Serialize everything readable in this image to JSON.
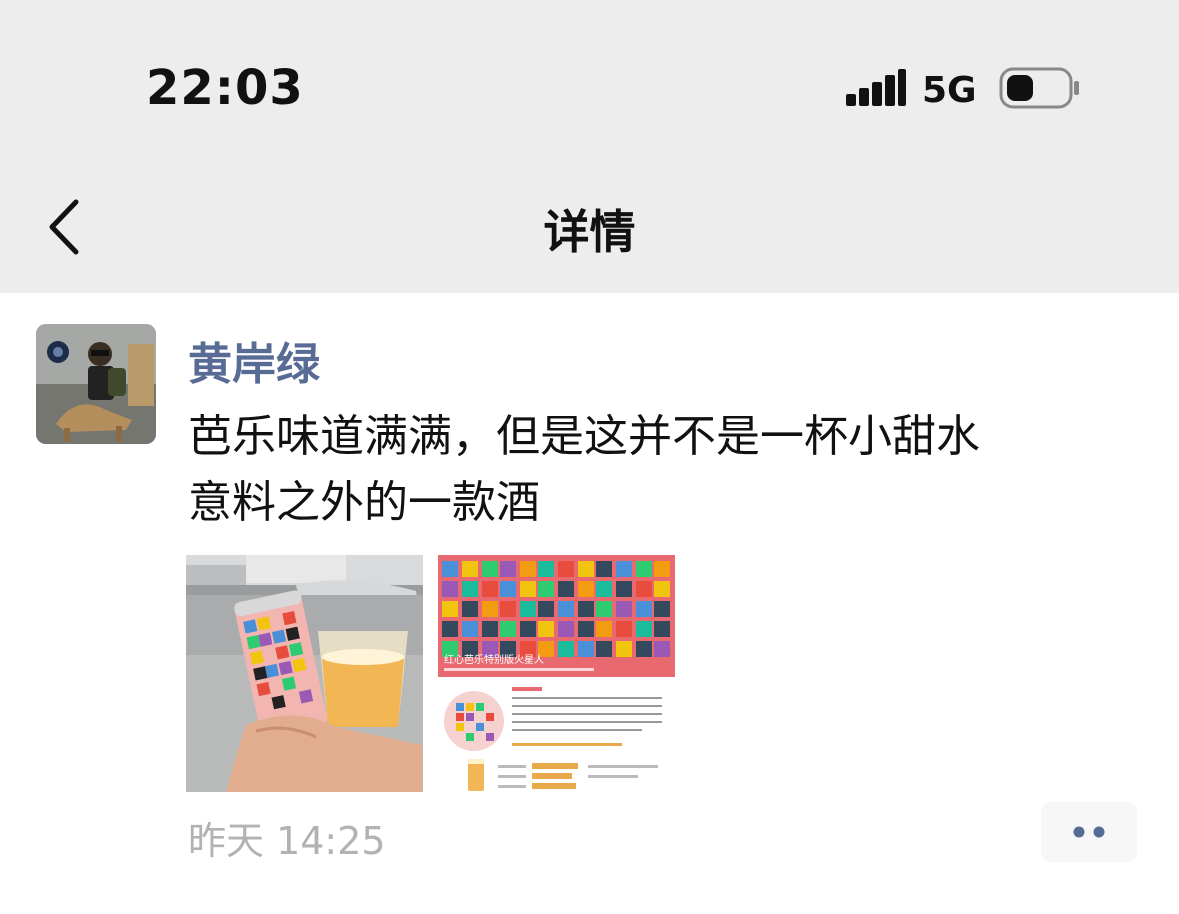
{
  "status_bar": {
    "time": "22:03",
    "network": "5G",
    "signal_icon": "signal-bars-icon",
    "battery_icon": "battery-icon"
  },
  "nav": {
    "back_icon": "chevron-left-icon",
    "title": "详情"
  },
  "post": {
    "author": "黄岸绿",
    "text_lines": [
      "芭乐味道满满，但是这并不是一杯小甜水",
      "意料之外的一款酒"
    ],
    "time": "昨天 14:25",
    "more_icon": "more-dots-icon",
    "poster_heading": "红心芭乐特别版火星人"
  },
  "colors": {
    "nav_background": "#ededed",
    "author_name": "#576b95",
    "timestamp": "#b2b2b2",
    "body_text": "#111111"
  }
}
